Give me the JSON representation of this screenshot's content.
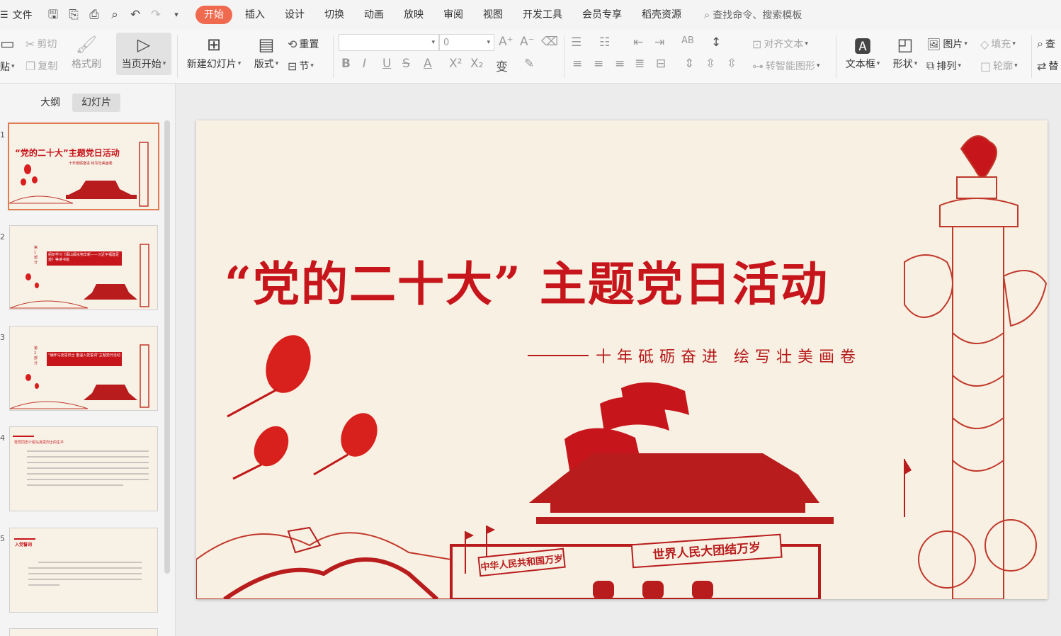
{
  "menubar": {
    "file_label": "文件",
    "tabs": [
      "开始",
      "插入",
      "设计",
      "切换",
      "动画",
      "放映",
      "审阅",
      "视图",
      "开发工具",
      "会员专享",
      "稻壳资源"
    ],
    "active_tab": "开始",
    "search_placeholder": "查找命令、搜索模板"
  },
  "ribbon": {
    "paste": "贴",
    "cut": "剪切",
    "copy": "复制",
    "format_painter": "格式刷",
    "play_from_current": "当页开始",
    "new_slide": "新建幻灯片",
    "layout": "版式",
    "reset": "重置",
    "section": "节",
    "font_size": "0",
    "align_text": "对齐文本",
    "smart_art": "转智能图形",
    "textbox": "文本框",
    "shape": "形状",
    "picture": "图片",
    "arrange": "排列",
    "fill": "填充",
    "outline": "轮廓",
    "find": "查",
    "replace": "替"
  },
  "panel": {
    "tab_outline": "大纲",
    "tab_slides": "幻灯片",
    "slides": [
      {
        "num": "1",
        "title": "“党的二十大”主题党日活动",
        "sub": "十年砥砺奋进 绘写壮美画卷"
      },
      {
        "num": "2",
        "part": "第1部分",
        "title": "组织学习《闽山闽水物华新——习近平福建足迹》等读书班"
      },
      {
        "num": "3",
        "part": "第2部分",
        "title": "“缅怀马克思烈士 重温入党誓词”主题党日活动"
      },
      {
        "num": "4",
        "title": "党员同志介绍马克思烈士的生平"
      },
      {
        "num": "5",
        "title": "入党誓词"
      }
    ]
  },
  "slide": {
    "title": "“党的二十大” 主题党日活动",
    "subtitle": "十年砥砺奋进 绘写壮美画卷",
    "banner_left": "中华人民共和国万岁",
    "banner_right": "世界人民大团结万岁"
  },
  "colors": {
    "accent": "#f06a4f",
    "slide_red": "#c7161b",
    "slide_bg": "#f8f0e3"
  }
}
